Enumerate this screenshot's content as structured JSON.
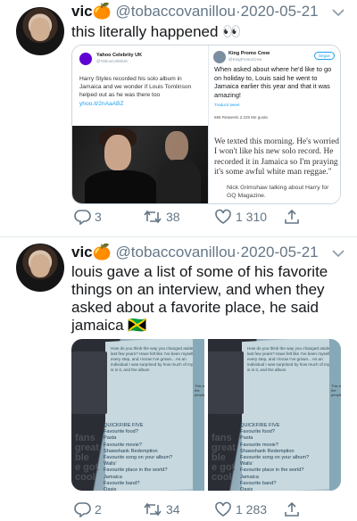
{
  "tweets": [
    {
      "name": "vic",
      "name_emoji": "🍊",
      "handle": "@tobaccovanillou",
      "separator": "·",
      "date": "2020-05-21",
      "text": "this literally happened 👀",
      "replies": "3",
      "retweets": "38",
      "likes": "1 310",
      "embedded": {
        "left_card": {
          "account": "Yahoo Celebrity UK",
          "account_handle": "@YahooCelebUK",
          "body": "Harry Styles recorded his solo album in Jamaica and we wonder if Louis Tomlinson helped out as he was there too",
          "link": "yhoo.it/2nAaABZ"
        },
        "right_card": {
          "account": "King Promo Crew",
          "account_handle": "@KingPromoCrew",
          "follow": "Seguir",
          "body": "When asked about where he'd like to go on holiday to, Louis said he went to Jamaica earlier this year and that it was amazing!",
          "translate": "Traducir tweet",
          "stats": "686 Retweets  2.225 Me gusta"
        },
        "quote": "We texted this morning. He's worried I won't like his new solo record. He recorded it in Jamaica so I'm praying it's some awful white man reggae.\"",
        "credit": "Nick Grimshaw talking about Harry for GQ Magazine."
      }
    },
    {
      "name": "vic",
      "name_emoji": "🍊",
      "handle": "@tobaccovanillou",
      "separator": "·",
      "date": "2020-05-21",
      "text": "louis gave a list of some of his favorite things on an interview, and when they asked about a favorite place, he said jamaica 🇯🇲",
      "replies": "2",
      "retweets": "34",
      "likes": "1 283",
      "magazine": {
        "questions": "QUICKFIRE FIVE\nFavourite food?\nPasta\nFavourite movie?\nShawshank Redemption\nFavourite song on your album?\nWalls'\nFavourite place in the world?\nJamaica\nFavourite band?\nOasis",
        "side_text": "fans\ngreat\nble\ne got\ncool",
        "small_text": "This is\nthe\npeople"
      }
    }
  ],
  "icons": {
    "reply": "reply-icon",
    "retweet": "retweet-icon",
    "like": "heart-icon",
    "share": "share-icon",
    "more": "chevron-down-icon"
  },
  "colors": {
    "text": "#14171a",
    "secondary": "#657786",
    "divider": "#e1e8ed",
    "link": "#1da1f2"
  }
}
